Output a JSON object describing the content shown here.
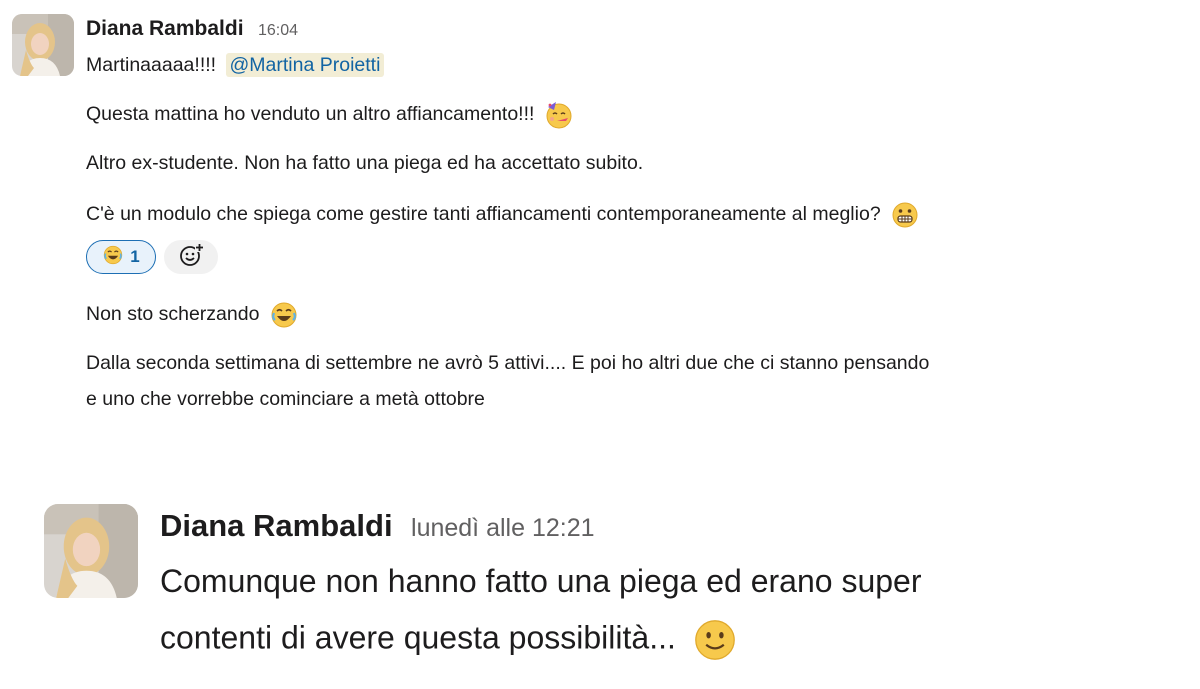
{
  "message1": {
    "author": "Diana Rambaldi",
    "time": "16:04",
    "line1_text": "Martinaaaaa!!!!",
    "mention": "@Martina Proietti",
    "line2": "Questa mattina ho venduto un altro affiancamento!!!",
    "line2_emoji": "partying-face-icon",
    "line3": "Altro ex-studente. Non ha fatto una piega ed ha accettato subito.",
    "line4": "C'è un modulo che spiega come gestire tanti affiancamenti contemporaneamente al meglio?",
    "line4_emoji": "grimacing-face-icon",
    "reaction": {
      "emoji": "joy-icon",
      "count": "1"
    },
    "add_reaction_icon": "add-reaction-icon",
    "line5": "Non sto scherzando",
    "line5_emoji": "joy-icon",
    "line6a": "Dalla seconda settimana di settembre ne avrò 5 attivi.... E poi ho altri due che ci stanno pensando",
    "line6b": "e uno che vorrebbe cominciare a metà ottobre"
  },
  "message2": {
    "author": "Diana Rambaldi",
    "time": "lunedì alle 12:21",
    "line1": "Comunque non hanno fatto una piega ed erano super",
    "line2": "contenti di avere questa possibilità...",
    "line2_emoji": "slightly-smiling-face-icon"
  },
  "colors": {
    "mention_bg": "#f2edd5",
    "mention_text": "#1264a3",
    "reaction_border": "#1d6fb4",
    "reaction_bg": "#e8f2fb",
    "timestamp": "#616061"
  }
}
